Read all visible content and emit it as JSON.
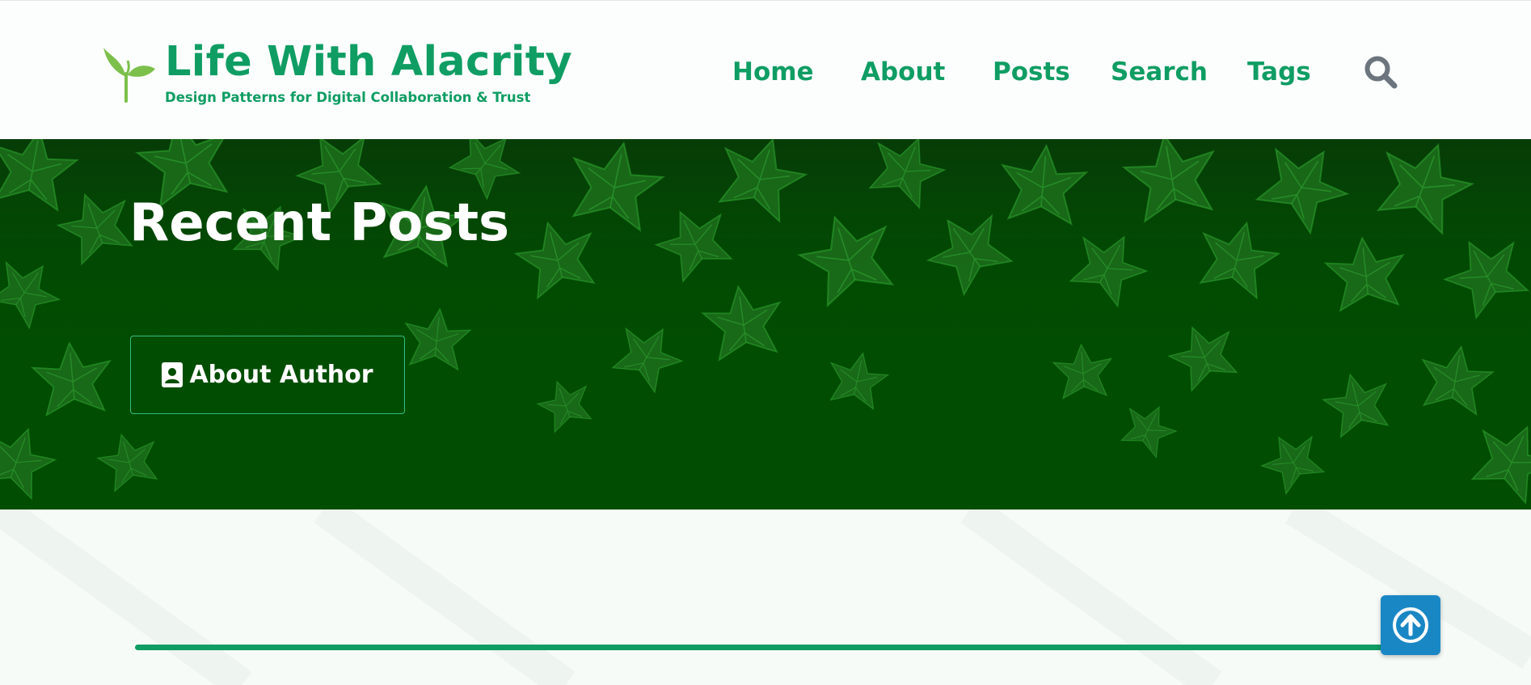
{
  "header": {
    "site_title": "Life With Alacrity",
    "tagline": "Design Patterns for Digital Collaboration & Trust",
    "logo_icon": "sprout-icon"
  },
  "nav": {
    "items": [
      {
        "label": "Home"
      },
      {
        "label": "About"
      },
      {
        "label": "Posts"
      },
      {
        "label": "Search"
      },
      {
        "label": "Tags"
      }
    ],
    "search_icon": "search-icon"
  },
  "hero": {
    "title": "Recent Posts",
    "author_button": {
      "label": "About Author",
      "icon": "contact-card-icon"
    },
    "background": "ivy-leaves"
  },
  "reading_progress": {
    "percent": 100
  },
  "back_to_top": {
    "icon": "arrow-up-circle-icon"
  },
  "colors": {
    "brand_green": "#0f9d63",
    "hero_green": "#014d02",
    "leaf_green": "#1f7a1f",
    "button_blue": "#1a87c5",
    "search_gray": "#6c757d"
  }
}
